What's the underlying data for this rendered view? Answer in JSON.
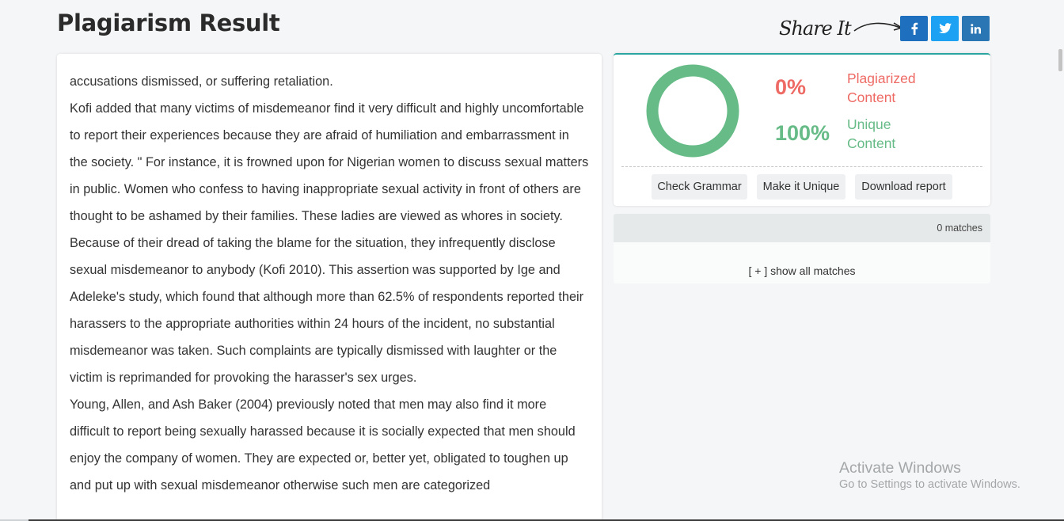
{
  "header": {
    "title": "Plagiarism Result",
    "share_label": "Share It"
  },
  "social": [
    {
      "network": "facebook",
      "icon": "facebook-icon",
      "color": "#1e70be"
    },
    {
      "network": "twitter",
      "icon": "twitter-icon",
      "color": "#1da1f2"
    },
    {
      "network": "linkedin",
      "icon": "linkedin-icon",
      "color": "#2a75b3"
    }
  ],
  "content": {
    "paragraphs": [
      "accusations dismissed, or suffering retaliation.",
      "Kofi added that many victims of misdemeanor find it very difficult and highly uncomfortable to report their experiences because they are afraid of humiliation and embarrassment in the society. \" For instance, it is frowned upon for Nigerian women to discuss sexual matters in public. Women who confess to having inappropriate sexual activity in front of others are thought to be ashamed by their families. These ladies are viewed as whores in society. Because of their dread of taking the blame for the situation, they infrequently disclose sexual misdemeanor to anybody (Kofi 2010). This assertion was supported by Ige and Adeleke's study, which found that although more than 62.5% of respondents reported their harassers to the appropriate authorities within 24 hours of the incident, no substantial misdemeanor was taken. Such complaints are typically dismissed with laughter or the victim is reprimanded for provoking the harasser's sex urges.",
      "Young, Allen, and Ash Baker (2004) previously noted that men may also find it more difficult to report being sexually harassed because it is socially expected that men should enjoy the company of women.  They are expected or, better yet, obligated to toughen up and put up with sexual misdemeanor otherwise such men are categorized"
    ]
  },
  "result": {
    "plagiarized_percent": "0%",
    "plagiarized_label": "Plagiarized Content",
    "unique_percent": "100%",
    "unique_label": "Unique Content",
    "plagiarized_fraction": 0,
    "colors": {
      "plagiarized": "#ee6a64",
      "unique": "#66bb87",
      "accent": "#2aa5a0"
    },
    "buttons": {
      "check_grammar": "Check Grammar",
      "make_unique": "Make it Unique",
      "download": "Download report"
    }
  },
  "matches": {
    "count_text": "0 matches",
    "show_all": "[ + ] show all matches"
  },
  "watermark": {
    "title": "Activate Windows",
    "subtitle": "Go to Settings to activate Windows."
  }
}
